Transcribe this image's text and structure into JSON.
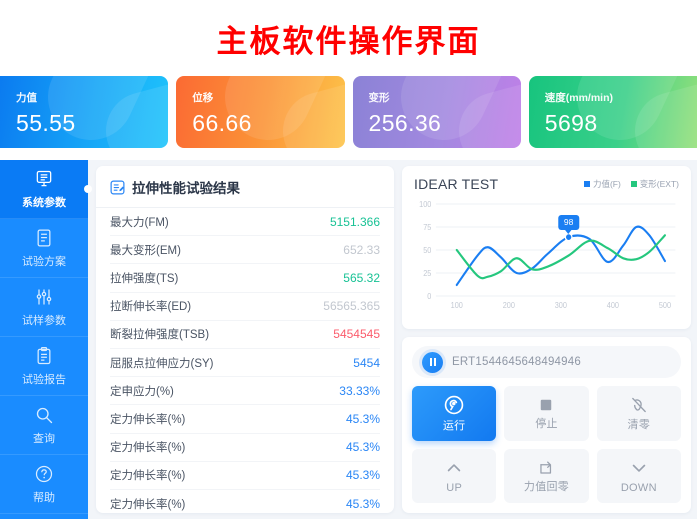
{
  "header": {
    "title": "主板软件操作界面",
    "title_color": "#ff0000"
  },
  "cards": [
    {
      "label": "力值",
      "value": "55.55",
      "theme": "c-blue",
      "color": "#16a6f7"
    },
    {
      "label": "位移",
      "value": "66.66",
      "theme": "c-orange",
      "color": "#fb9237"
    },
    {
      "label": "变形",
      "value": "256.36",
      "theme": "c-purple",
      "color": "#a389e0"
    },
    {
      "label": "速度(mm/min)",
      "value": "5698",
      "theme": "c-green",
      "color": "#3bd08a"
    }
  ],
  "sidebar": {
    "items": [
      {
        "label": "系统参数",
        "icon": "monitor-doc-icon",
        "active": true
      },
      {
        "label": "试验方案",
        "icon": "document-icon",
        "active": false
      },
      {
        "label": "试样参数",
        "icon": "sliders-icon",
        "active": false
      },
      {
        "label": "试验报告",
        "icon": "clipboard-icon",
        "active": false
      },
      {
        "label": "查询",
        "icon": "search-icon",
        "active": false
      },
      {
        "label": "帮助",
        "icon": "question-circle-icon",
        "active": false
      }
    ]
  },
  "results": {
    "title": "拉伸性能试验结果",
    "icon": "edit-document-icon",
    "rows": [
      {
        "label": "最大力(FM)",
        "value": "5151.366",
        "color_class": "v-green"
      },
      {
        "label": "最大变形(EM)",
        "value": "652.33",
        "color_class": "v-gray"
      },
      {
        "label": "拉伸强度(TS)",
        "value": "565.32",
        "color_class": "v-green"
      },
      {
        "label": "拉断伸长率(ED)",
        "value": "56565.365",
        "color_class": "v-gray"
      },
      {
        "label": "断裂拉伸强度(TSB)",
        "value": "5454545",
        "color_class": "v-red"
      },
      {
        "label": "屈服点拉伸应力(SY)",
        "value": "5454",
        "color_class": "v-blue"
      },
      {
        "label": "定申应力(%)",
        "value": "33.33%",
        "color_class": "v-blue"
      },
      {
        "label": "定力伸长率(%)",
        "value": "45.3%",
        "color_class": "v-blue"
      },
      {
        "label": "定力伸长率(%)",
        "value": "45.3%",
        "color_class": "v-blue"
      },
      {
        "label": "定力伸长率(%)",
        "value": "45.3%",
        "color_class": "v-blue"
      },
      {
        "label": "定力伸长率(%)",
        "value": "45.3%",
        "color_class": "v-blue"
      }
    ]
  },
  "chart_data": {
    "type": "line",
    "title": "IDEAR TEST",
    "xlabel": "",
    "ylabel": "",
    "xlim": [
      60,
      520
    ],
    "ylim": [
      0,
      100
    ],
    "xticks": [
      "100",
      "200",
      "300",
      "400",
      "500"
    ],
    "yticks": [
      "0",
      "25",
      "50",
      "75",
      "100"
    ],
    "grid": true,
    "legend_position": "top-right",
    "legend": [
      {
        "name": "力值(F)",
        "color": "#1a7ef2"
      },
      {
        "name": "变形(EXT)",
        "color": "#25c77e"
      }
    ],
    "annotation": {
      "label": "98",
      "x": 315,
      "y": 64
    },
    "x": [
      100,
      140,
      160,
      185,
      215,
      245,
      275,
      315,
      355,
      390,
      420,
      445,
      470,
      500
    ],
    "series": [
      {
        "name": "力值(F)",
        "color": "#1a7ef2",
        "values": [
          12,
          44,
          53,
          42,
          25,
          30,
          46,
          64,
          62,
          37,
          55,
          75,
          66,
          38
        ]
      },
      {
        "name": "变形(EXT)",
        "color": "#25c77e",
        "values": [
          50,
          22,
          21,
          27,
          41,
          29,
          32,
          44,
          60,
          52,
          41,
          40,
          48,
          66
        ]
      }
    ]
  },
  "control": {
    "id_text": "ERT1544645648494946",
    "pause_icon": "pause-icon",
    "buttons": [
      {
        "label": "运行",
        "icon": "play-circle-icon",
        "primary": true
      },
      {
        "label": "停止",
        "icon": "stop-square-icon",
        "primary": false
      },
      {
        "label": "清零",
        "icon": "clear-slash-icon",
        "primary": false
      },
      {
        "label": "UP",
        "icon": "chevron-up-icon",
        "primary": false
      },
      {
        "label": "力值回零",
        "icon": "reset-loop-icon",
        "primary": false
      },
      {
        "label": "DOWN",
        "icon": "chevron-down-icon",
        "primary": false
      }
    ]
  }
}
